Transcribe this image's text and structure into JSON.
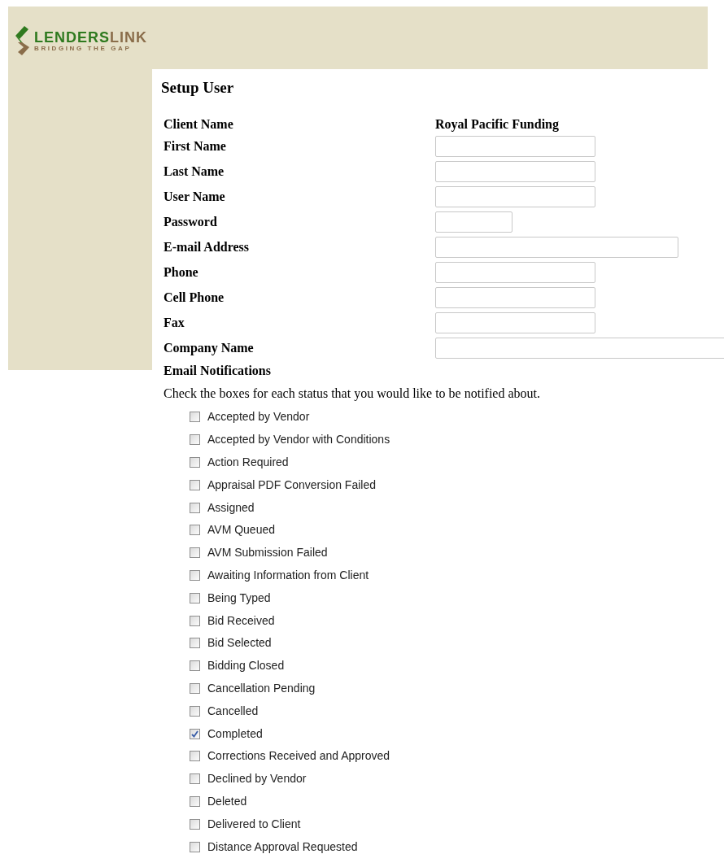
{
  "logo": {
    "primary": "LENDERS",
    "secondary": "LINK",
    "tagline": "BRIDGING THE GAP"
  },
  "title": "Setup User",
  "fields": [
    {
      "label": "Client Name",
      "kind": "value",
      "value": "Royal Pacific Funding"
    },
    {
      "label": "First Name",
      "kind": "medium"
    },
    {
      "label": "Last Name",
      "kind": "medium"
    },
    {
      "label": "User Name",
      "kind": "medium"
    },
    {
      "label": "Password",
      "kind": "short"
    },
    {
      "label": "E-mail Address",
      "kind": "long"
    },
    {
      "label": "Phone",
      "kind": "medium"
    },
    {
      "label": "Cell Phone",
      "kind": "medium"
    },
    {
      "label": "Fax",
      "kind": "medium"
    },
    {
      "label": "Company Name",
      "kind": "wide"
    }
  ],
  "notifications": {
    "heading": "Email Notifications",
    "instructions": "Check the boxes for each status that you would like to be notified about.",
    "statuses": [
      {
        "label": "Accepted by Vendor",
        "checked": false
      },
      {
        "label": "Accepted by Vendor with Conditions",
        "checked": false
      },
      {
        "label": "Action Required",
        "checked": false
      },
      {
        "label": "Appraisal PDF Conversion Failed",
        "checked": false
      },
      {
        "label": "Assigned",
        "checked": false
      },
      {
        "label": "AVM Queued",
        "checked": false
      },
      {
        "label": "AVM Submission Failed",
        "checked": false
      },
      {
        "label": "Awaiting Information from Client",
        "checked": false
      },
      {
        "label": "Being Typed",
        "checked": false
      },
      {
        "label": "Bid Received",
        "checked": false
      },
      {
        "label": "Bid Selected",
        "checked": false
      },
      {
        "label": "Bidding Closed",
        "checked": false
      },
      {
        "label": "Cancellation Pending",
        "checked": false
      },
      {
        "label": "Cancelled",
        "checked": false
      },
      {
        "label": "Completed",
        "checked": true
      },
      {
        "label": "Corrections Received and Approved",
        "checked": false
      },
      {
        "label": "Declined by Vendor",
        "checked": false
      },
      {
        "label": "Deleted",
        "checked": false
      },
      {
        "label": "Delivered to Client",
        "checked": false
      },
      {
        "label": "Distance Approval Requested",
        "checked": false
      }
    ]
  }
}
